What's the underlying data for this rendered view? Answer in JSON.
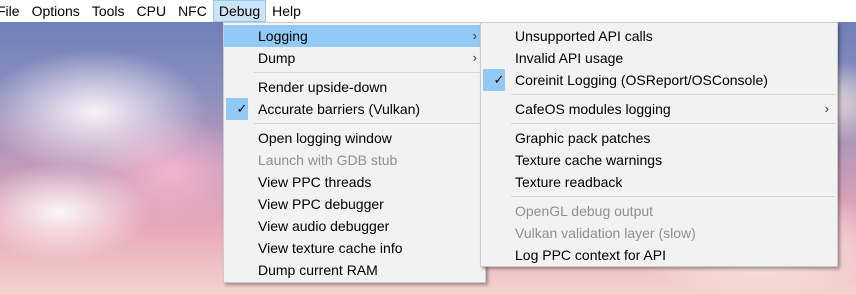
{
  "menubar": {
    "items": [
      "File",
      "Options",
      "Tools",
      "CPU",
      "NFC",
      "Debug",
      "Help"
    ],
    "active": "Debug"
  },
  "debug_menu": {
    "logging": "Logging",
    "dump": "Dump",
    "render_upside_down": "Render upside-down",
    "accurate_barriers": "Accurate barriers (Vulkan)",
    "open_logging_window": "Open logging window",
    "launch_gdb_stub": "Launch with GDB stub",
    "view_ppc_threads": "View PPC threads",
    "view_ppc_debugger": "View PPC debugger",
    "view_audio_debugger": "View audio debugger",
    "view_texture_cache": "View texture cache info",
    "dump_ram": "Dump current RAM",
    "submenu_arrow": "›",
    "check_mark": "✓"
  },
  "logging_menu": {
    "unsupported_api": "Unsupported API calls",
    "invalid_api": "Invalid API usage",
    "coreinit_logging": "Coreinit Logging (OSReport/OSConsole)",
    "cafeos_modules": "CafeOS modules logging",
    "graphic_pack": "Graphic pack patches",
    "texture_cache_warnings": "Texture cache warnings",
    "texture_readback": "Texture readback",
    "opengl_debug": "OpenGL debug output",
    "vulkan_validation": "Vulkan validation layer (slow)",
    "log_ppc_context": "Log PPC context for API",
    "submenu_arrow": "›",
    "check_mark": "✓"
  },
  "colors": {
    "highlight": "#91c9f7",
    "menubar_active": "#cce4f7",
    "disabled_text": "#8f8f8f"
  }
}
